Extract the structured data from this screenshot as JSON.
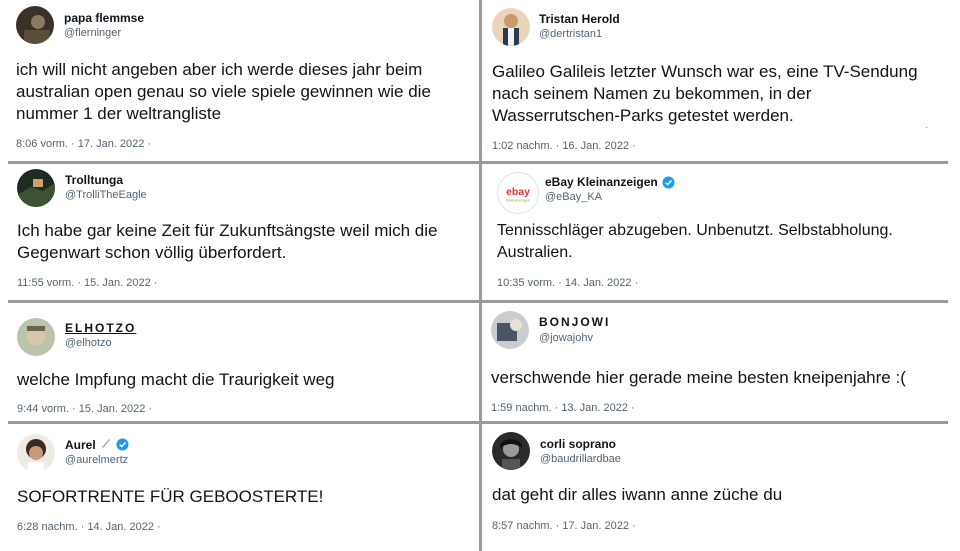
{
  "tweets": [
    {
      "name": "papa flemmse",
      "handle": "@flerninger",
      "text": "ich will nicht angeben aber ich werde dieses jahr beim australian open genau so viele spiele gewinnen wie die nummer 1 der weltrangliste",
      "time": "8:06 vorm. · 17. Jan. 2022 ·"
    },
    {
      "name": "Tristan Herold",
      "handle": "@dertristan1",
      "text": "Galileo Galileis letzter Wunsch war es, eine TV-Sendung nach seinem Namen zu bekommen, in der Wasserrutschen-Parks getestet werden.",
      "time": "1:02 nachm. · 16. Jan. 2022 ·"
    },
    {
      "name": "Trolltunga",
      "handle": "@TrolliTheEagle",
      "text": "Ich habe gar keine Zeit für Zukunftsängste weil mich die Gegenwart schon völlig überfordert.",
      "time": "11:55 vorm. · 15. Jan. 2022 ·"
    },
    {
      "name": "eBay Kleinanzeigen",
      "handle": "@eBay_KA",
      "text": "Tennisschläger abzugeben. Unbenutzt. Selbstabholung. Australien.",
      "time": "10:35 vorm. · 14. Jan. 2022 ·",
      "verified": true,
      "logo_text": "ebay",
      "logo_sub": "Kleinanzeigen"
    },
    {
      "name": "ELHOTZO",
      "handle": "@elhotzo",
      "text": "welche Impfung macht die Traurigkeit weg",
      "time": "9:44 vorm. · 15. Jan. 2022 ·"
    },
    {
      "name": "BONJOWI",
      "handle": "@jowajohv",
      "text": "verschwende hier gerade meine besten kneipenjahre :(",
      "time": "1:59 nachm. · 13. Jan. 2022 ·"
    },
    {
      "name": "Aurel",
      "handle": "@aurelmertz",
      "text": "SOFORTRENTE FÜR GEBOOSTERTE!",
      "time": "6:28 nachm. · 14. Jan. 2022 ·",
      "verified": true
    },
    {
      "name": "corli soprano",
      "handle": "@baudrillardbae",
      "text": "dat geht dir alles iwann anne züche du",
      "time": "8:57 nachm. · 17. Jan. 2022 ·"
    }
  ],
  "colors": {
    "verified": "#1d9bf0",
    "divider": "#9a9a9a"
  }
}
